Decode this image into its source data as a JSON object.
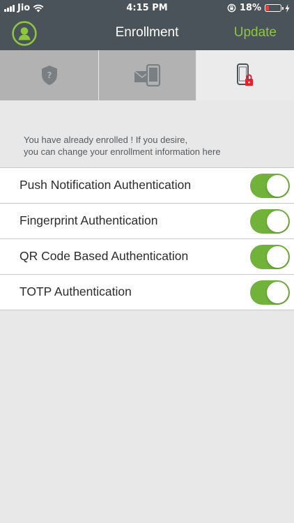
{
  "status_bar": {
    "carrier": "Jio",
    "time": "4:15 PM",
    "battery_percent": "18%",
    "battery_level": 0.18,
    "icons": [
      "signal-icon",
      "wifi-icon",
      "rotation-lock-icon",
      "battery-icon",
      "charging-icon"
    ]
  },
  "header": {
    "title": "Enrollment",
    "update_label": "Update",
    "avatar_icon": "user-avatar-icon"
  },
  "tabs": [
    {
      "icon": "shield-question-icon",
      "selected": false
    },
    {
      "icon": "mail-phone-icon",
      "selected": false
    },
    {
      "icon": "phone-lock-icon",
      "selected": true
    }
  ],
  "info": {
    "line1": "You have already enrolled ! If you desire,",
    "line2": "you can change your enrollment information here"
  },
  "settings": [
    {
      "label": "Push Notification Authentication",
      "enabled": true
    },
    {
      "label": "Fingerprint Authentication",
      "enabled": true
    },
    {
      "label": "QR Code Based Authentication",
      "enabled": true
    },
    {
      "label": "TOTP Authentication",
      "enabled": true
    }
  ],
  "colors": {
    "header_bg": "#4b535a",
    "accent_green": "#8dc63f",
    "toggle_on": "#70b23a",
    "tab_inactive": "#b2b2b2",
    "lock_red": "#e8202a",
    "page_bg": "#e8e8e8"
  }
}
